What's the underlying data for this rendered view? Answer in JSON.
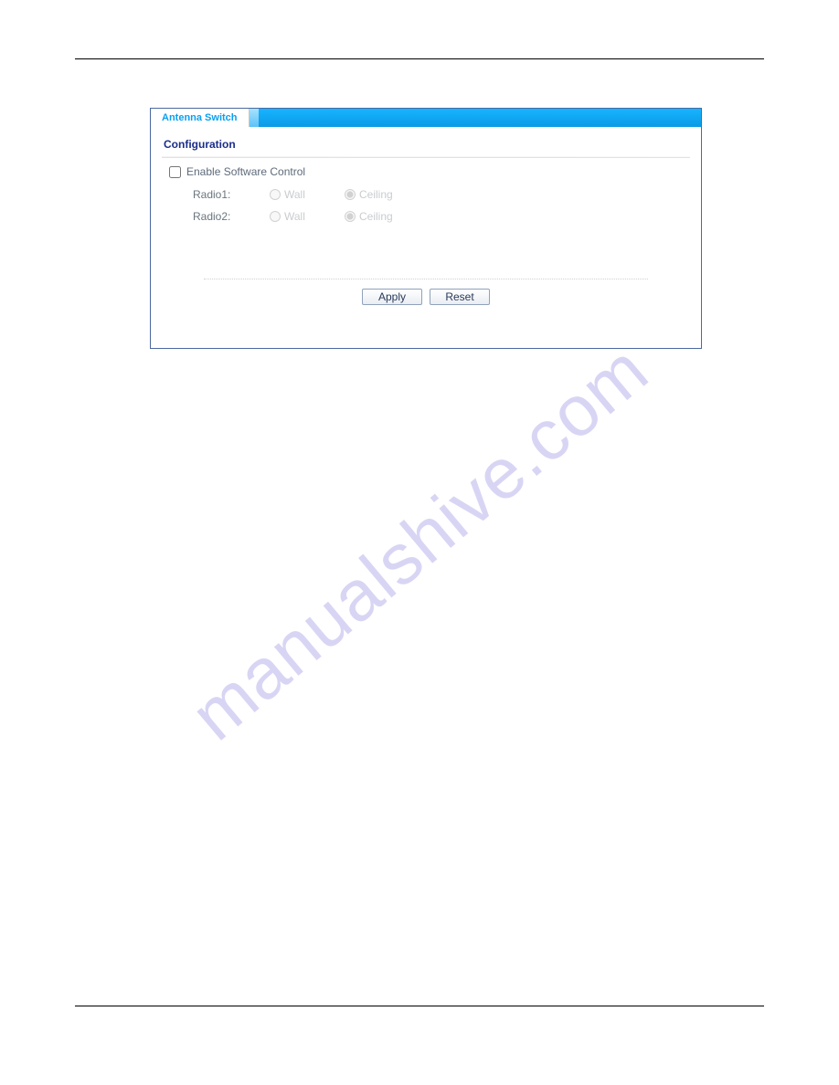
{
  "watermark": "manualshive.com",
  "panel": {
    "tab": {
      "label": "Antenna Switch"
    },
    "section_title": "Configuration",
    "enable": {
      "label": "Enable Software Control",
      "checked": false
    },
    "rows": [
      {
        "label": "Radio1:",
        "options": [
          {
            "label": "Wall",
            "selected": false
          },
          {
            "label": "Ceiling",
            "selected": true
          }
        ]
      },
      {
        "label": "Radio2:",
        "options": [
          {
            "label": "Wall",
            "selected": false
          },
          {
            "label": "Ceiling",
            "selected": true
          }
        ]
      }
    ],
    "buttons": {
      "apply": "Apply",
      "reset": "Reset"
    }
  }
}
